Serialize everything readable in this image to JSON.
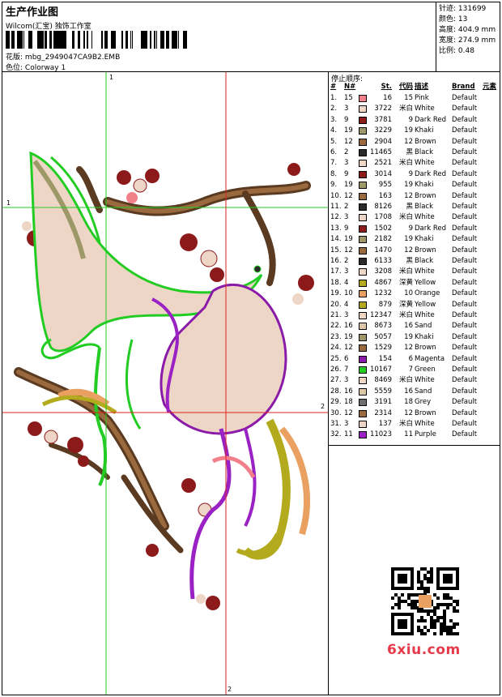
{
  "header": {
    "title": "生产作业图",
    "company": "Wilcom(汇宝) 独饰工作室",
    "pattern_label": "花版:",
    "pattern_value": "mbg_2949047CA9B2.EMB",
    "colorway_label": "色位:",
    "colorway_value": "Colorway 1"
  },
  "stats": [
    {
      "label": "针迹:",
      "value": "131699"
    },
    {
      "label": "颜色:",
      "value": "13"
    },
    {
      "label": "高度:",
      "value": "404.9 mm"
    },
    {
      "label": "宽度:",
      "value": "274.9 mm"
    },
    {
      "label": "比例:",
      "value": "0.48"
    }
  ],
  "design": {
    "axis_labels": {
      "v1_top": "1",
      "h1_left": "1",
      "h2_right": "2",
      "v2_bottom": "2"
    }
  },
  "sequence": {
    "title": "停止顺序:",
    "headers": {
      "idx": "#",
      "n": "N#",
      "st": "St.",
      "code": "代码",
      "desc": "描述",
      "brand": "Brand",
      "elem": "元素"
    },
    "rows": [
      {
        "idx": "1.",
        "n": "15",
        "st": "16",
        "code": "15",
        "desc": "Pink",
        "brand": "Default",
        "color": "#f2808a"
      },
      {
        "idx": "2.",
        "n": "3",
        "st": "3722",
        "code": "米白",
        "desc": "White",
        "brand": "Default",
        "color": "#eed6c6"
      },
      {
        "idx": "3.",
        "n": "9",
        "st": "3781",
        "code": "9",
        "desc": "Dark Red",
        "brand": "Default",
        "color": "#8c1a1a"
      },
      {
        "idx": "4.",
        "n": "19",
        "st": "3229",
        "code": "19",
        "desc": "Khaki",
        "brand": "Default",
        "color": "#9c9868"
      },
      {
        "idx": "5.",
        "n": "12",
        "st": "2904",
        "code": "12",
        "desc": "Brown",
        "brand": "Default",
        "color": "#9a6a3e"
      },
      {
        "idx": "6.",
        "n": "2",
        "st": "11465",
        "code": "黑",
        "desc": "Black",
        "brand": "Default",
        "color": "#2a2a2a"
      },
      {
        "idx": "7.",
        "n": "3",
        "st": "2521",
        "code": "米白",
        "desc": "White",
        "brand": "Default",
        "color": "#eed6c6"
      },
      {
        "idx": "8.",
        "n": "9",
        "st": "3014",
        "code": "9",
        "desc": "Dark Red",
        "brand": "Default",
        "color": "#8c1a1a"
      },
      {
        "idx": "9.",
        "n": "19",
        "st": "955",
        "code": "19",
        "desc": "Khaki",
        "brand": "Default",
        "color": "#9c9868"
      },
      {
        "idx": "10.",
        "n": "12",
        "st": "163",
        "code": "12",
        "desc": "Brown",
        "brand": "Default",
        "color": "#9a6a3e"
      },
      {
        "idx": "11.",
        "n": "2",
        "st": "8126",
        "code": "黑",
        "desc": "Black",
        "brand": "Default",
        "color": "#2a2a2a"
      },
      {
        "idx": "12.",
        "n": "3",
        "st": "1708",
        "code": "米白",
        "desc": "White",
        "brand": "Default",
        "color": "#eed6c6"
      },
      {
        "idx": "13.",
        "n": "9",
        "st": "1502",
        "code": "9",
        "desc": "Dark Red",
        "brand": "Default",
        "color": "#8c1a1a"
      },
      {
        "idx": "14.",
        "n": "19",
        "st": "2182",
        "code": "19",
        "desc": "Khaki",
        "brand": "Default",
        "color": "#9c9868"
      },
      {
        "idx": "15.",
        "n": "12",
        "st": "1470",
        "code": "12",
        "desc": "Brown",
        "brand": "Default",
        "color": "#9a6a3e"
      },
      {
        "idx": "16.",
        "n": "2",
        "st": "6133",
        "code": "黑",
        "desc": "Black",
        "brand": "Default",
        "color": "#2a2a2a"
      },
      {
        "idx": "17.",
        "n": "3",
        "st": "3208",
        "code": "米白",
        "desc": "White",
        "brand": "Default",
        "color": "#eed6c6"
      },
      {
        "idx": "18.",
        "n": "4",
        "st": "4867",
        "code": "深黄",
        "desc": "Yellow",
        "brand": "Default",
        "color": "#b4aa1e"
      },
      {
        "idx": "19.",
        "n": "10",
        "st": "1232",
        "code": "10",
        "desc": "Orange",
        "brand": "Default",
        "color": "#e9a060"
      },
      {
        "idx": "20.",
        "n": "4",
        "st": "879",
        "code": "深黄",
        "desc": "Yellow",
        "brand": "Default",
        "color": "#b4aa1e"
      },
      {
        "idx": "21.",
        "n": "3",
        "st": "12347",
        "code": "米白",
        "desc": "White",
        "brand": "Default",
        "color": "#eed6c6"
      },
      {
        "idx": "22.",
        "n": "16",
        "st": "8673",
        "code": "16",
        "desc": "Sand",
        "brand": "Default",
        "color": "#dcc8a8"
      },
      {
        "idx": "23.",
        "n": "19",
        "st": "5057",
        "code": "19",
        "desc": "Khaki",
        "brand": "Default",
        "color": "#9c9868"
      },
      {
        "idx": "24.",
        "n": "12",
        "st": "1529",
        "code": "12",
        "desc": "Brown",
        "brand": "Default",
        "color": "#9a6a3e"
      },
      {
        "idx": "25.",
        "n": "6",
        "st": "154",
        "code": "6",
        "desc": "Magenta",
        "brand": "Default",
        "color": "#8a1aa8"
      },
      {
        "idx": "26.",
        "n": "7",
        "st": "10167",
        "code": "7",
        "desc": "Green",
        "brand": "Default",
        "color": "#22cc22"
      },
      {
        "idx": "27.",
        "n": "3",
        "st": "8469",
        "code": "米白",
        "desc": "White",
        "brand": "Default",
        "color": "#eed6c6"
      },
      {
        "idx": "28.",
        "n": "16",
        "st": "5559",
        "code": "16",
        "desc": "Sand",
        "brand": "Default",
        "color": "#dcc8a8"
      },
      {
        "idx": "29.",
        "n": "18",
        "st": "3191",
        "code": "18",
        "desc": "Grey",
        "brand": "Default",
        "color": "#6e6e6e"
      },
      {
        "idx": "30.",
        "n": "12",
        "st": "2314",
        "code": "12",
        "desc": "Brown",
        "brand": "Default",
        "color": "#9a6a3e"
      },
      {
        "idx": "31.",
        "n": "3",
        "st": "137",
        "code": "米白",
        "desc": "White",
        "brand": "Default",
        "color": "#eed6c6"
      },
      {
        "idx": "32.",
        "n": "11",
        "st": "11023",
        "code": "11",
        "desc": "Purple",
        "brand": "Default",
        "color": "#9a22c4"
      }
    ]
  },
  "watermark": "6xiu.com",
  "colors": {
    "axis1": "#22cc22",
    "axis2": "#dd2222",
    "watermark": "#e63a4a"
  },
  "icons": {
    "qr": "qr-code-icon",
    "barcode": "barcode-icon"
  }
}
